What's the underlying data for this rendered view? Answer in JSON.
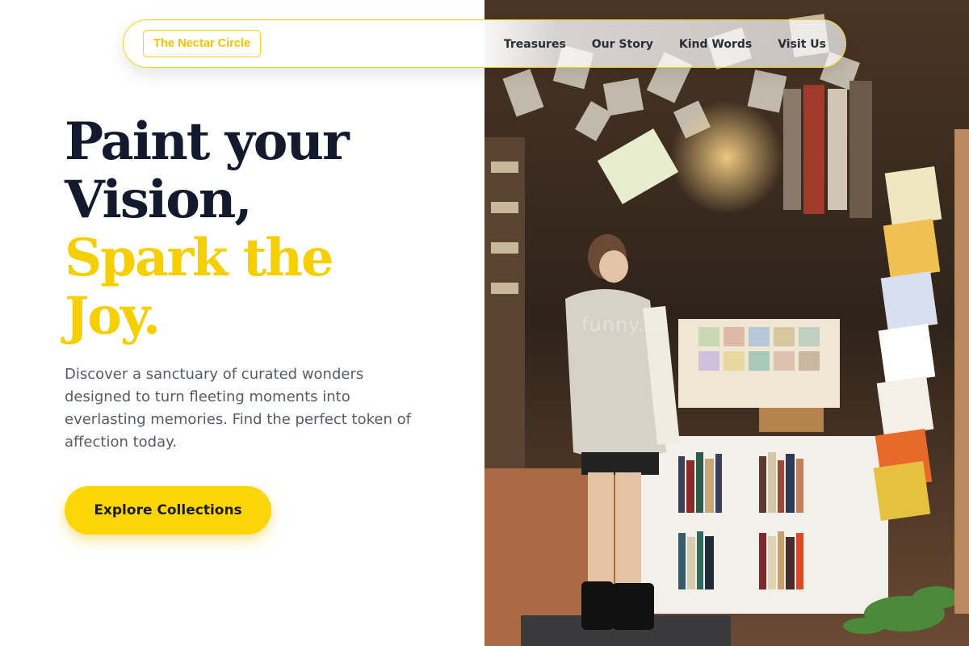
{
  "colors": {
    "accent": "#fdd607",
    "accent_text": "#f5cf00",
    "heading": "#141a2e",
    "body_text": "#555a66"
  },
  "header": {
    "brand": "The Nectar Circle",
    "nav": [
      {
        "label": "Treasures"
      },
      {
        "label": "Our Story"
      },
      {
        "label": "Kind Words"
      },
      {
        "label": "Visit Us"
      }
    ]
  },
  "hero": {
    "title_lines": [
      "Paint your",
      "Vision,"
    ],
    "accent_lines": [
      "Spark the",
      "Joy."
    ],
    "description": "Discover a sanctuary of curated wonders designed to turn fleeting moments into everlasting memories. Find the perfect token of affection today.",
    "cta_label": "Explore Collections"
  },
  "photo": {
    "watermark": "funny...."
  }
}
